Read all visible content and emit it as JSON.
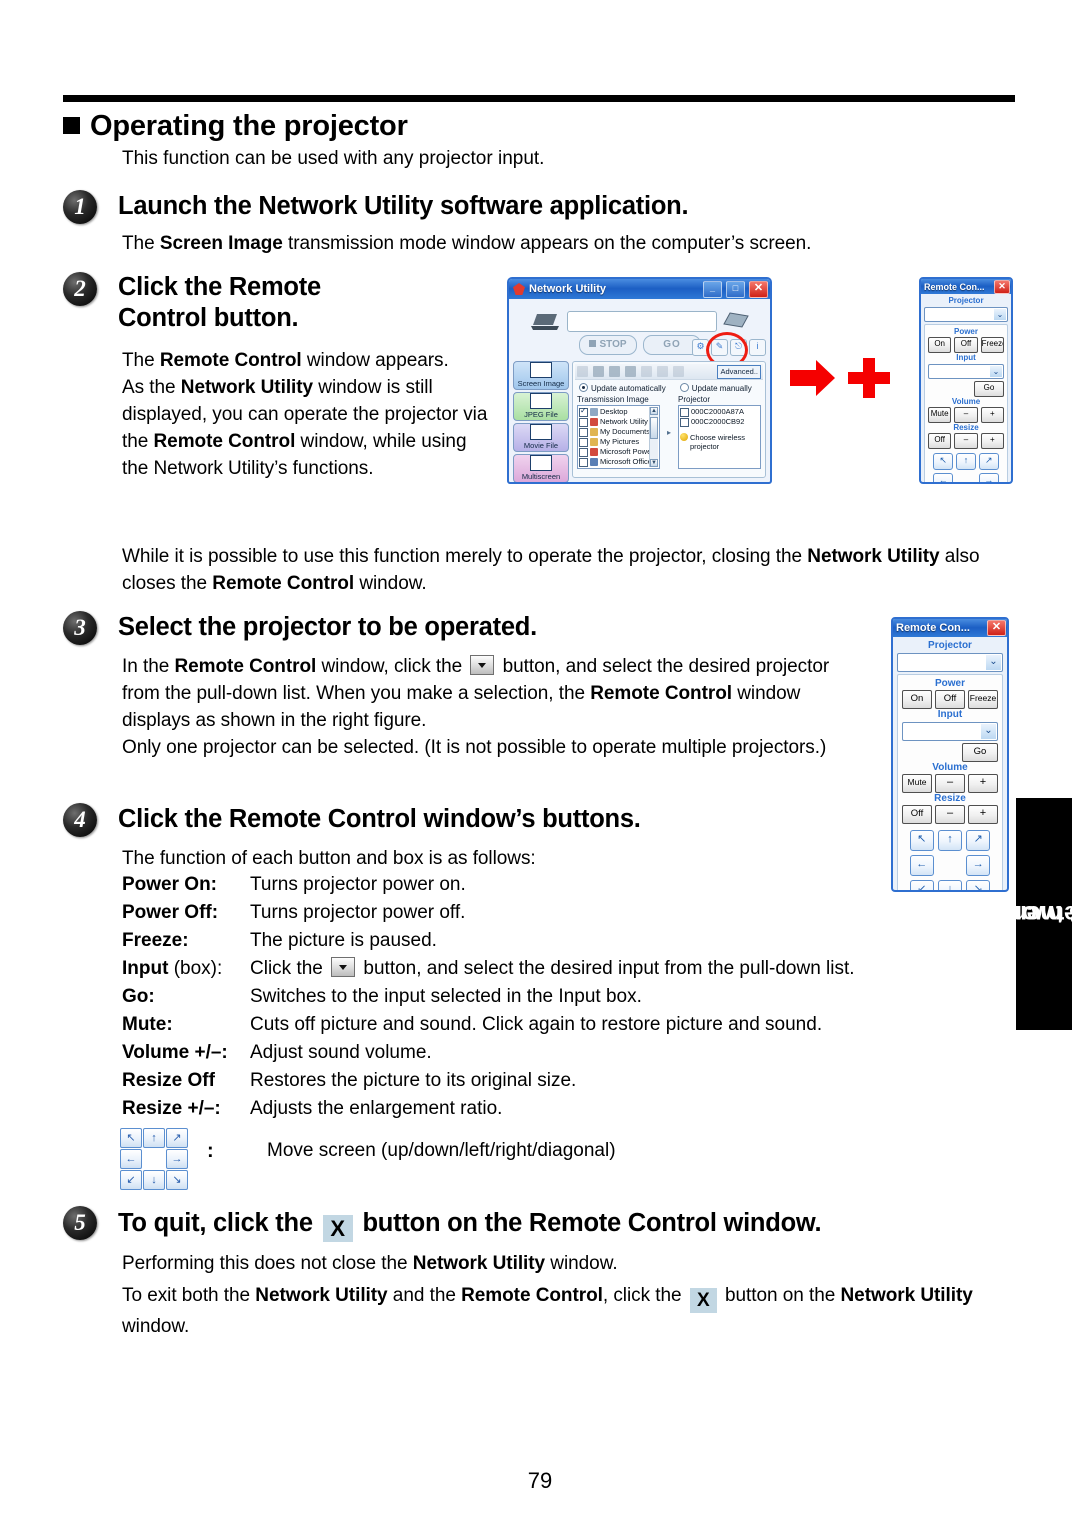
{
  "page": {
    "number": "79",
    "side_tab_line1": "Network/",
    "side_tab_line2": "USB memory"
  },
  "section": {
    "heading": "Operating the projector",
    "subtext": "This function can be used with any projector input."
  },
  "steps": {
    "s1": {
      "num": "1",
      "title": "Launch the Network Utility software application.",
      "body_html": "The <b>Screen Image</b> transmission mode window appears on the computer’s screen."
    },
    "s2": {
      "num": "2",
      "title_line1": "Click the Remote",
      "title_line2": "Control button.",
      "body_html": "The <b>Remote Control</b> window appears.<br>As the <b>Network Utility</b> window is still displayed, you can operate the projector via the <b>Remote Control</b> window, while using the Network Utility’s functions.",
      "body2_html": "While it is possible to use this function merely to operate the projector, closing the <b>Network Utility</b> also closes the <b>Remote Control</b> window."
    },
    "s3": {
      "num": "3",
      "title": "Select the projector to be operated.",
      "body_html_a": "In the <b>Remote Control</b> window, click the ",
      "body_html_b": " button, and select the desired projector from the pull-down list. When you make a selection, the <b>Remote Control</b> window displays as shown in  the right figure.<br>Only one projector can be selected. (It is not possible to operate multiple projectors.)"
    },
    "s4": {
      "num": "4",
      "title": "Click the Remote Control window’s buttons.",
      "intro": "The function of each button and box is as follows:",
      "functions": [
        {
          "term": "Power On:",
          "def": "Turns projector power on."
        },
        {
          "term": "Power Off:",
          "def": "Turns projector power off."
        },
        {
          "term": "Freeze:",
          "def": "The picture is paused."
        },
        {
          "term": "Input",
          "term_plain": " (box):",
          "def_a": "Click the ",
          "def_b": " button, and select the desired input from the pull-down list.",
          "has_dropdown": true
        },
        {
          "term": "Go:",
          "def": "Switches to the input selected in the Input box."
        },
        {
          "term": "Mute:",
          "def": "Cuts off picture and sound. Click again to restore picture and sound."
        },
        {
          "term": "Volume +/–:",
          "def": "Adjust sound volume."
        },
        {
          "term": "Resize Off",
          "def": "Restores the picture to its original size."
        },
        {
          "term": "Resize +/–:",
          "def": "Adjusts the enlargement ratio."
        }
      ],
      "move_colon": ":",
      "move_text": "Move screen (up/down/left/right/diagonal)"
    },
    "s5": {
      "num": "5",
      "title_a": "To quit, click the ",
      "title_x": "X",
      "title_b": " button on the Remote Control window.",
      "body1_html": "Performing this does not close the <b>Network Utility</b> window.",
      "body2_html_a": "To exit both the <b>Network Utility</b> and the <b>Remote Control</b>, click the ",
      "body2_x": "X",
      "body2_html_b": " button on the <b>Network Utility</b> window."
    }
  },
  "network_utility_figure": {
    "title": "Network Utility",
    "min_label": "_",
    "max_label": "□",
    "close_label": "✕",
    "stop_label": "STOP",
    "go_label": "GO",
    "advanced_label": "Advanced..",
    "radio_auto": "Update automatically",
    "radio_manual": "Update manually",
    "transmission_header": "Transmission Image",
    "projector_header": "Projector",
    "transmission_items": [
      {
        "label": "Desktop",
        "checked": true,
        "color": "#8fa8c4"
      },
      {
        "label": "Network Utility",
        "checked": false,
        "color": "#d24a3e"
      },
      {
        "label": "My Documents",
        "checked": false,
        "color": "#e0b552"
      },
      {
        "label": "My Pictures",
        "checked": false,
        "color": "#e0b552"
      },
      {
        "label": "Microsoft Power",
        "checked": false,
        "color": "#d24a3e"
      },
      {
        "label": "Microsoft Office",
        "checked": false,
        "color": "#5a7fb5"
      }
    ],
    "projector_items": [
      {
        "label": "000C2000A87A",
        "checked": false
      },
      {
        "label": "000C2000CB92",
        "checked": false
      }
    ],
    "choose_wireless": "Choose wireless projector",
    "side_tabs": [
      {
        "label": "Screen Image"
      },
      {
        "label": "JPEG File"
      },
      {
        "label": "Movie File"
      },
      {
        "label": "Multiscreen"
      }
    ]
  },
  "remote_control_figure": {
    "title": "Remote Con...",
    "close_label": "✕",
    "projector_label": "Projector",
    "power_label": "Power",
    "power_on": "On",
    "power_off": "Off",
    "freeze": "Freeze",
    "input_label": "Input",
    "go": "Go",
    "volume_label": "Volume",
    "mute": "Mute",
    "minus": "–",
    "plus": "+",
    "resize_label": "Resize",
    "resize_off": "Off",
    "arrows": [
      "↖",
      "↑",
      "↗",
      "←",
      "",
      "→",
      "↙",
      "↓",
      "↘"
    ]
  },
  "colors": {
    "accent_blue": "#2f6fd0",
    "red": "#ee1c12",
    "title_black": "#000000"
  }
}
